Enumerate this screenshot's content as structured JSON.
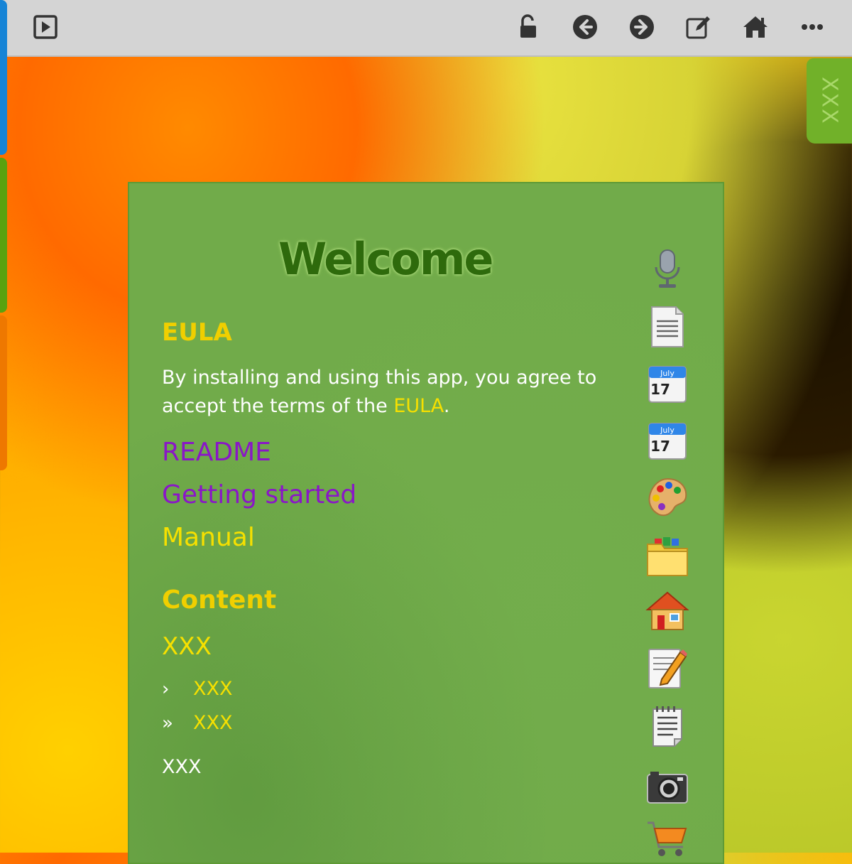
{
  "toolbar": {
    "buttons": [
      "play-box-icon",
      "unlock-icon",
      "back-arrow-icon",
      "forward-arrow-icon",
      "edit-icon",
      "home-icon",
      "more-icon"
    ]
  },
  "right_tab": {
    "label": "XXX"
  },
  "panel": {
    "title": "Welcome",
    "eula_heading": "EULA",
    "eula_text_before": "By installing and using this app, you agree to accept the terms of the ",
    "eula_link": "EULA",
    "eula_text_after": ".",
    "readme": "README",
    "getting_started": "Getting started",
    "manual": "Manual",
    "content_heading": "Content",
    "content_item": "XXX",
    "sub_items": [
      {
        "chevron": "›",
        "label": "XXX"
      },
      {
        "chevron": "»",
        "label": "XXX"
      }
    ],
    "footer_item": "XXX"
  },
  "side_icons": [
    {
      "name": "microphone-icon"
    },
    {
      "name": "document-icon"
    },
    {
      "name": "calendar-icon",
      "month": "July",
      "day": "17"
    },
    {
      "name": "calendar-icon",
      "month": "July",
      "day": "17"
    },
    {
      "name": "palette-icon"
    },
    {
      "name": "folder-icon"
    },
    {
      "name": "house-icon"
    },
    {
      "name": "note-pencil-icon"
    },
    {
      "name": "notepad-icon"
    },
    {
      "name": "camera-icon"
    },
    {
      "name": "shopping-cart-icon"
    }
  ],
  "colors": {
    "panel": "#71ab4a",
    "heading_yellow": "#f6e000",
    "link_purple": "#8a16c8",
    "title_green": "#2e6a0c",
    "toolbar": "#d4d4d4"
  }
}
